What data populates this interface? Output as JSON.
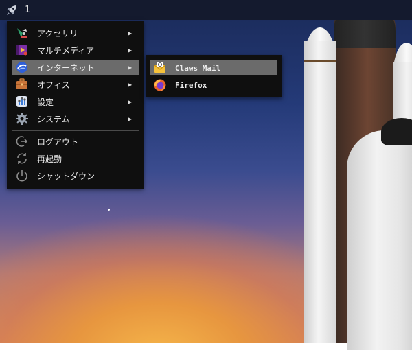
{
  "panel": {
    "launcher_icon": "rocket-icon",
    "workspace_number": "1"
  },
  "main_menu": {
    "items": [
      {
        "label": "アクセサリ",
        "icon": "accessories-icon",
        "has_submenu": true
      },
      {
        "label": "マルチメディア",
        "icon": "multimedia-icon",
        "has_submenu": true
      },
      {
        "label": "インターネット",
        "icon": "internet-icon",
        "has_submenu": true,
        "active": true
      },
      {
        "label": "オフィス",
        "icon": "office-briefcase-icon",
        "has_submenu": true
      },
      {
        "label": "設定",
        "icon": "settings-icon",
        "has_submenu": true
      },
      {
        "label": "システム",
        "icon": "system-gear-icon",
        "has_submenu": true
      }
    ],
    "session_items": [
      {
        "label": "ログアウト",
        "icon": "logout-icon"
      },
      {
        "label": "再起動",
        "icon": "reboot-icon"
      },
      {
        "label": "シャットダウン",
        "icon": "power-icon"
      }
    ],
    "submenu_arrow": "▶"
  },
  "internet_submenu": {
    "items": [
      {
        "label": "Claws Mail",
        "icon": "claws-mail-icon",
        "active": true
      },
      {
        "label": "Firefox",
        "icon": "firefox-icon"
      }
    ]
  },
  "colors": {
    "menu_bg": "#0f0f0f",
    "highlight": "#6b6b6b",
    "panel_bg": "#141a2e"
  }
}
